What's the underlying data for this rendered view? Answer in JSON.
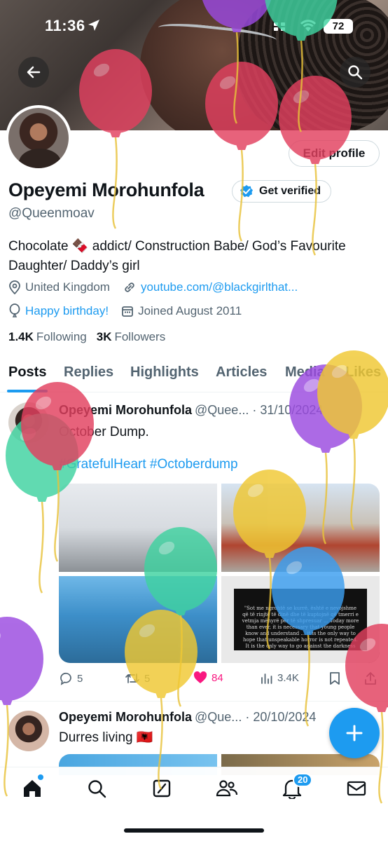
{
  "status_bar": {
    "time": "11:36",
    "battery": "72"
  },
  "profile": {
    "name": "Opeyemi Morohunfola",
    "handle": "@Queenmoav",
    "verify_label": "Get verified",
    "edit_label": "Edit profile",
    "bio": "Chocolate 🍫 addict/ Construction Babe/ God’s Favourite Daughter/ Daddy’s girl",
    "location": "United Kingdom",
    "website": "youtube.com/@blackgirlthat...",
    "birthday": "Happy birthday!",
    "joined": "Joined August 2011",
    "following_count": "1.4K",
    "following_label": "Following",
    "followers_count": "3K",
    "followers_label": "Followers"
  },
  "tabs": [
    "Posts",
    "Replies",
    "Highlights",
    "Articles",
    "Media",
    "Likes"
  ],
  "posts": [
    {
      "name": "Opeyemi Morohunfola",
      "handle": "@Quee...",
      "date": "· 31/10/2024",
      "text": "October Dump.",
      "hashtags": "#GratefulHeart #Octoberdump",
      "plaque_text": "\"Sot me ngrohtë se kurrë, është e nevojshme që të rinjtë të dinë dhe të kuptojnë që tmerri e vetmja mënyrë për të shpresuar ... Today more than ever, it is necessary that young people know and understand ... it is the only way to hope that unspeakable horror is not repeated. It is the only way to go against the darkness",
      "replies": "5",
      "reposts": "5",
      "likes": "84",
      "views": "3.4K"
    },
    {
      "name": "Opeyemi Morohunfola",
      "handle": "@Que...",
      "date": "· 20/10/2024",
      "text": "Durres living 🇦🇱"
    }
  ],
  "nav": {
    "notifications_badge": "20"
  },
  "colors": {
    "accent": "#1d9bf0",
    "like": "#f91880",
    "text": "#0f1419",
    "muted": "#536471"
  },
  "balloon_colors": [
    "#e2405f",
    "#9b4ae0",
    "#f0c832",
    "#3fd2a0",
    "#3b9ef0"
  ]
}
